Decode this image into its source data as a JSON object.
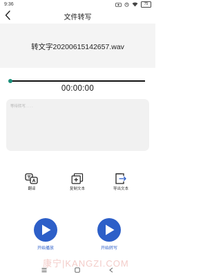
{
  "status_bar": {
    "time": "9:36",
    "battery": "75"
  },
  "header": {
    "title": "文件转写"
  },
  "file": {
    "name": "转文字20200615142657.wav"
  },
  "player": {
    "time": "00:00:00",
    "progress": 0
  },
  "result": {
    "placeholder": "等待转写. . . ."
  },
  "actions": [
    {
      "label": "翻译",
      "icon": "translate-icon"
    },
    {
      "label": "复制文本",
      "icon": "copy-icon"
    },
    {
      "label": "导出文本",
      "icon": "export-icon"
    }
  ],
  "buttons": {
    "play": {
      "label": "开始播放",
      "icon": "play-icon"
    },
    "transcribe": {
      "label": "开始转写",
      "icon": "play-icon"
    }
  },
  "watermark": "康宁|KANGZI.COM",
  "colors": {
    "accent": "#2d5fc8",
    "progress_thumb": "#1b8f7a",
    "card_bg": "#f4f4f4"
  }
}
